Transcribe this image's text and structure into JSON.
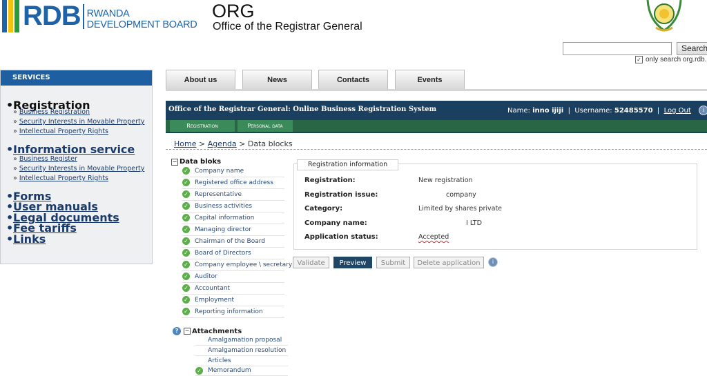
{
  "header": {
    "logo_text": "RDB",
    "logo_line1": "RWANDA",
    "logo_line2": "DEVELOPMENT BOARD",
    "org_title": "ORG",
    "org_subtitle": "Office of the Registrar General",
    "flag_colors": [
      "#1e63a8",
      "#f4c20d",
      "#2a9a3a"
    ],
    "emblem_icon": "national-emblem-icon"
  },
  "search": {
    "value": "",
    "button": "Search",
    "only_search_label": "only search org.rdb.r",
    "only_search_checked": true
  },
  "services": {
    "title": "SERVICES",
    "registration": {
      "label": "Registration",
      "items": [
        "Business Registration",
        "Security Interests in Movable Property",
        "Intellectual Property Rights"
      ]
    },
    "information": {
      "label": "Information service",
      "items": [
        "Business Register",
        "Security Interests in Movable Property",
        "Intellectual Property Rights"
      ]
    },
    "links": [
      "Forms",
      "User manuals",
      "Legal documents",
      "Fee tariffs",
      "Links"
    ]
  },
  "tabs": [
    "About us",
    "News",
    "Contacts",
    "Events"
  ],
  "system": {
    "title": "Office of the Registrar General: Online Business Registration System",
    "name_label": "Name:",
    "name_value": "inno    ijiji",
    "username_label": "Username:",
    "username_value": "52485570",
    "logout": "Log Out",
    "subtabs": [
      "Registration",
      "Personal data"
    ]
  },
  "breadcrumb": {
    "home": "Home",
    "agenda": "Agenda",
    "current": "Data blocks",
    "sep": ">"
  },
  "blocks": {
    "title": "Data bloks",
    "items": [
      "Company name",
      "Registered office address",
      "Representative",
      "Business activities",
      "Capital information",
      "Managing director",
      "Chairman of the Board",
      "Board of Directors",
      "Company employee \\ secretary",
      "Auditor",
      "Accountant",
      "Employment",
      "Reporting information"
    ],
    "attachments_title": "Attachments",
    "attachments": [
      "Amalgamation proposal",
      "Amalgamation resolution",
      "Articles",
      "Memorandum"
    ]
  },
  "registration_info": {
    "legend": "Registration information",
    "rows": [
      {
        "label": "Registration:",
        "value": "New registration"
      },
      {
        "label": "Registration issue:",
        "value": "company"
      },
      {
        "label": "Category:",
        "value": "Limited by shares private"
      },
      {
        "label": "Company name:",
        "value": "I LTD"
      },
      {
        "label": "Application status:",
        "value": "Accepted"
      }
    ]
  },
  "actions": {
    "validate": "Validate",
    "preview": "Preview",
    "submit": "Submit",
    "delete": "Delete application"
  }
}
